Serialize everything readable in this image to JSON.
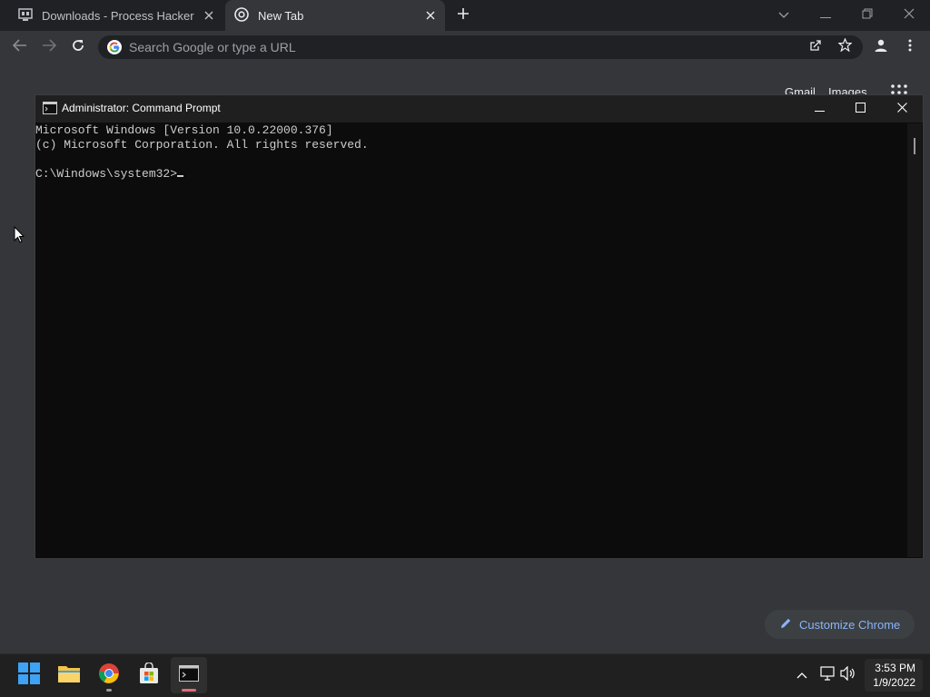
{
  "chrome": {
    "tabs": [
      {
        "label": "Downloads - Process Hacker",
        "icon": "process-hacker-icon",
        "active": false
      },
      {
        "label": "New Tab",
        "icon": "chrome-icon",
        "active": true
      }
    ],
    "omnibox": {
      "placeholder": "Search Google or type a URL"
    },
    "ntp": {
      "links": [
        "Gmail",
        "Images"
      ],
      "customize_label": "Customize Chrome"
    }
  },
  "cmd": {
    "title": "Administrator: Command Prompt",
    "lines": [
      "Microsoft Windows [Version 10.0.22000.376]",
      "(c) Microsoft Corporation. All rights reserved.",
      "",
      "C:\\Windows\\system32>"
    ]
  },
  "taskbar": {
    "apps": [
      "start-icon",
      "file-explorer-icon",
      "chrome-icon",
      "microsoft-store-icon",
      "terminal-icon"
    ],
    "clock": {
      "time": "3:53 PM",
      "date": "1/9/2022"
    }
  },
  "colors": {
    "accent": "#8ab4f8",
    "taskbar_active": "#e06c75"
  }
}
